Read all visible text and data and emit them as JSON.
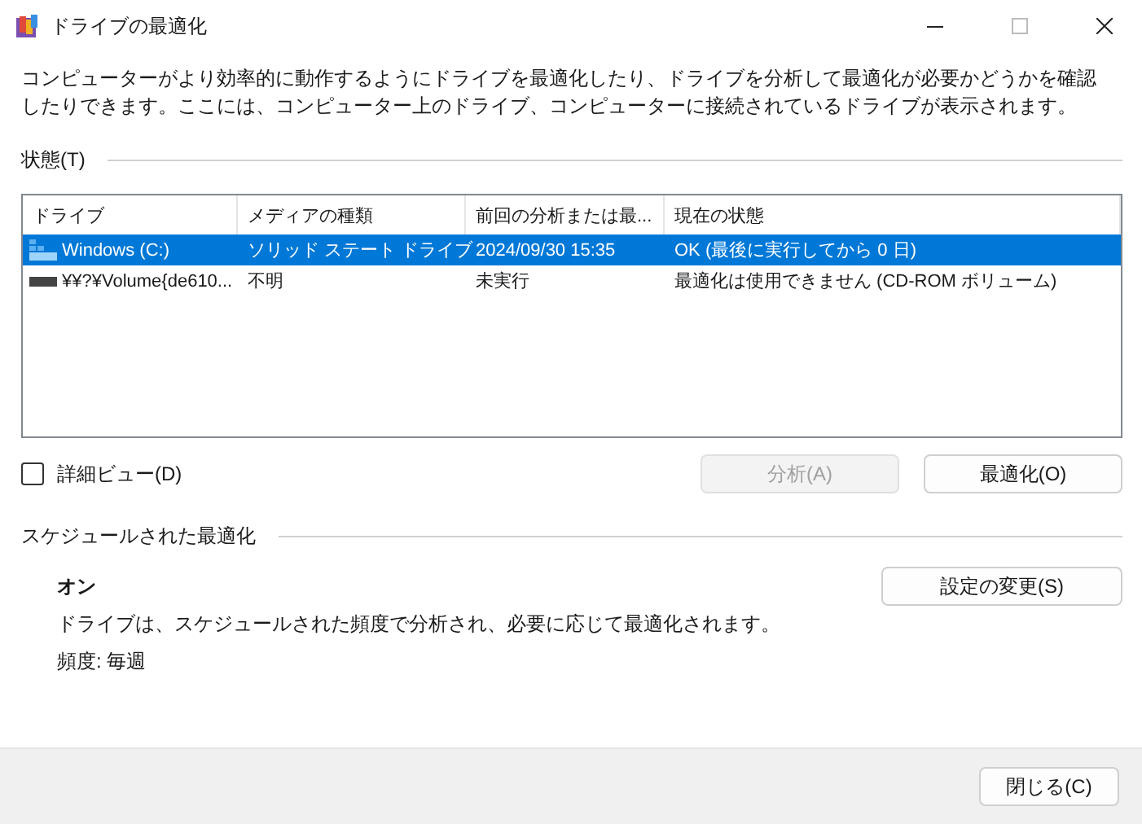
{
  "window": {
    "title": "ドライブの最適化"
  },
  "description": "コンピューターがより効率的に動作するようにドライブを最適化したり、ドライブを分析して最適化が必要かどうかを確認したりできます。ここには、コンピューター上のドライブ、コンピューターに接続されているドライブが表示されます。",
  "status_section": {
    "label": "状態(T)"
  },
  "table": {
    "columns": [
      "ドライブ",
      "メディアの種類",
      "前回の分析または最...",
      "現在の状態"
    ],
    "rows": [
      {
        "kind": "ssd",
        "selected": true,
        "cells": [
          "Windows  (C:)",
          "ソリッド ステート ドライブ",
          "2024/09/30 15:35",
          "OK (最後に実行してから 0 日)"
        ]
      },
      {
        "kind": "optical",
        "selected": false,
        "cells": [
          "¥¥?¥Volume{de610...",
          "不明",
          "未実行",
          "最適化は使用できません (CD-ROM ボリューム)"
        ]
      }
    ]
  },
  "detail_view": {
    "label": "詳細ビュー(D)",
    "checked": false
  },
  "actions": [
    {
      "label": "分析(A)",
      "disabled": true
    },
    {
      "label": "最適化(O)",
      "disabled": false
    }
  ],
  "schedule": {
    "label": "スケジュールされた最適化",
    "state": "オン",
    "description": "ドライブは、スケジュールされた頻度で分析され、必要に応じて最適化されます。",
    "frequency": "頻度: 毎週",
    "button": "設定の変更(S)"
  },
  "footer": {
    "button": "閉じる(C)"
  }
}
